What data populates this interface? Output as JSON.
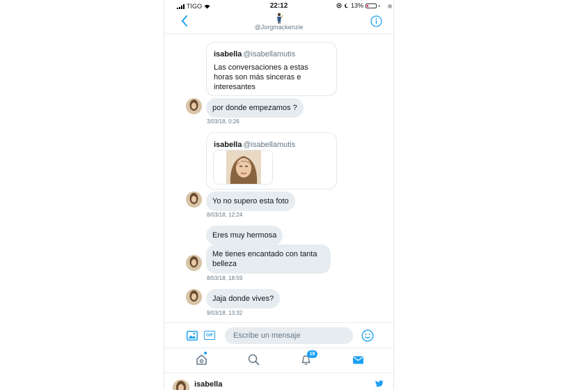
{
  "status_bar": {
    "carrier": "TIGO",
    "time": "22:12",
    "battery": "13%"
  },
  "header": {
    "handle": "@Jorgmackenzie"
  },
  "messages": [
    {
      "type": "quote",
      "name": "isabella",
      "handle": "@isabellamutis",
      "text": "Las conversaciones a estas horas son más sinceras e interesantes"
    },
    {
      "type": "bubble",
      "text": "por donde empezamos ?"
    },
    {
      "type": "timestamp",
      "text": "3/03/18, 0:26"
    },
    {
      "type": "quote_image",
      "name": "isabella",
      "handle": "@isabellamutis"
    },
    {
      "type": "bubble",
      "text": "Yo no supero esta foto"
    },
    {
      "type": "timestamp",
      "text": "8/03/18, 12:24"
    },
    {
      "type": "bubble",
      "text": "Eres muy hermosa"
    },
    {
      "type": "bubble",
      "text": "Me tienes encantado con tanta belleza"
    },
    {
      "type": "timestamp",
      "text": "8/03/18, 18:59"
    },
    {
      "type": "bubble",
      "text": "Jaja donde vives?"
    },
    {
      "type": "timestamp",
      "text": "9/03/18, 13:32"
    }
  ],
  "compose": {
    "placeholder": "Escribe un mensaje",
    "gif_label": "GIF"
  },
  "tabbar": {
    "notifications_badge": "19"
  },
  "tweet_preview": {
    "name": "isabella"
  },
  "colors": {
    "accent": "#1da1f2",
    "bubble": "#e6ecf0",
    "muted": "#657786"
  },
  "icons": [
    "back-chevron-icon",
    "info-icon",
    "image-icon",
    "gif-icon",
    "emoji-icon",
    "home-icon",
    "search-icon",
    "bell-icon",
    "mail-icon",
    "twitter-bird-icon"
  ]
}
